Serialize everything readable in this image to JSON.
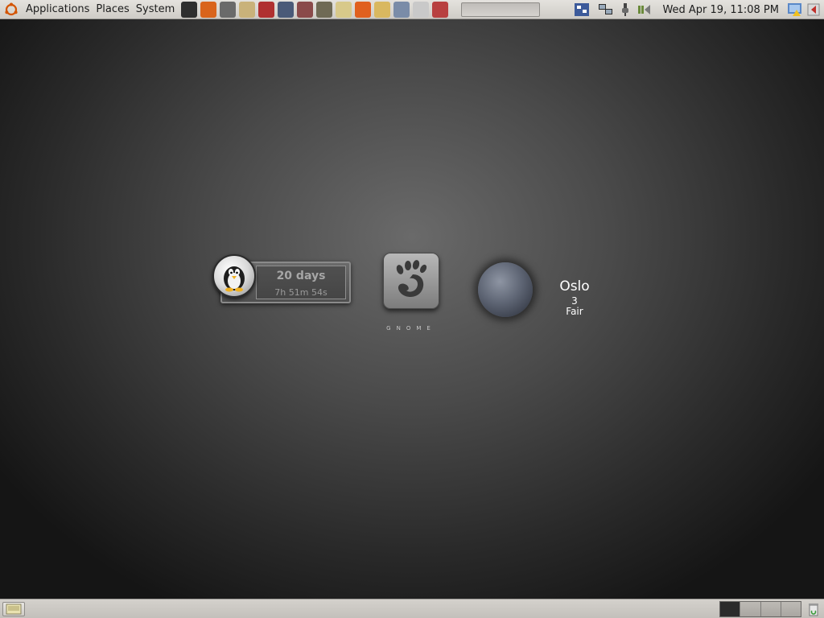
{
  "top_panel": {
    "menus": [
      "Applications",
      "Places",
      "System"
    ],
    "launchers": [
      {
        "name": "terminal-icon",
        "color": "#2e2e2e"
      },
      {
        "name": "firefox-icon",
        "color": "#d9641c"
      },
      {
        "name": "camera-icon",
        "color": "#6a6a6a"
      },
      {
        "name": "folder-icon",
        "color": "#c9b27a"
      },
      {
        "name": "books-icon",
        "color": "#b03030"
      },
      {
        "name": "remote-icon",
        "color": "#4a5a78"
      },
      {
        "name": "grid-tool-icon",
        "color": "#8a4a4a"
      },
      {
        "name": "gimp-icon",
        "color": "#6f6a55"
      },
      {
        "name": "pidgin-icon",
        "color": "#d8c98a"
      },
      {
        "name": "chat-icon",
        "color": "#e0601e"
      },
      {
        "name": "disc-icon",
        "color": "#d9b860"
      },
      {
        "name": "cd-burner-icon",
        "color": "#7a8ca8"
      },
      {
        "name": "media-disc-icon",
        "color": "#c9c9c9"
      },
      {
        "name": "bookshelf-icon",
        "color": "#b84040"
      }
    ],
    "tray": [
      {
        "name": "puzzle-applet-icon"
      },
      {
        "name": "network-icon"
      },
      {
        "name": "power-icon"
      },
      {
        "name": "volume-icon"
      }
    ],
    "clock": "Wed Apr 19, 11:08 PM",
    "right_tray": [
      {
        "name": "update-notifier-icon"
      },
      {
        "name": "shutdown-icon"
      }
    ]
  },
  "desktop": {
    "uptime": {
      "days": "20 days",
      "time": "7h 51m 54s"
    },
    "gnome_label": "GNOME",
    "weather": {
      "city": "Oslo",
      "temp": "3",
      "condition": "Fair"
    }
  },
  "bottom_panel": {
    "workspaces": [
      {
        "active": true
      },
      {
        "active": false
      },
      {
        "active": false
      },
      {
        "active": false
      }
    ]
  }
}
